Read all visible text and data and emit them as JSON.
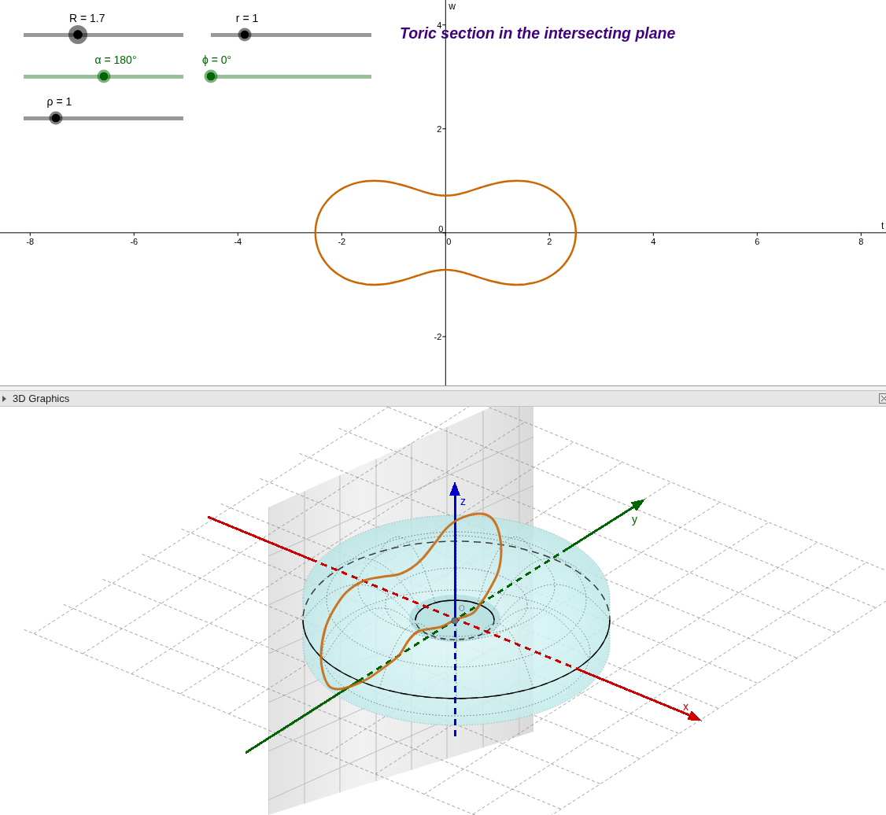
{
  "graphics_2d": {
    "title": "Toric section in the intersecting plane",
    "sliders": [
      {
        "label": "R = 1.7",
        "level": 0.34,
        "color": "#000000",
        "selected": true
      },
      {
        "label": "r = 1",
        "level": 0.21,
        "color": "#000000",
        "selected": false
      },
      {
        "label": "α = 180°",
        "level": 0.5,
        "color": "#006400",
        "selected": false
      },
      {
        "label": "ϕ = 0°",
        "level": 0,
        "color": "#006400",
        "selected": false
      },
      {
        "label": "ρ = 1",
        "level": 0.2,
        "color": "#000000",
        "selected": false
      }
    ],
    "chart_data": {
      "type": "line",
      "xlabel": "t",
      "ylabel": "w",
      "xlim": [
        -8.58,
        8.48
      ],
      "ylim": [
        -2.94,
        4.48
      ],
      "xticks": [
        -8,
        -6,
        -4,
        -2,
        0,
        2,
        4,
        6,
        8
      ],
      "yticks": [
        -2,
        0,
        2,
        4
      ]
    }
  },
  "graphics_3d": {
    "header": {
      "title": "3D Graphics"
    },
    "axes": [
      {
        "label": "x",
        "color": "#cc0000"
      },
      {
        "label": "y",
        "color": "#006400"
      },
      {
        "label": "z",
        "color": "#0000cc"
      }
    ],
    "origin_label": "O"
  }
}
